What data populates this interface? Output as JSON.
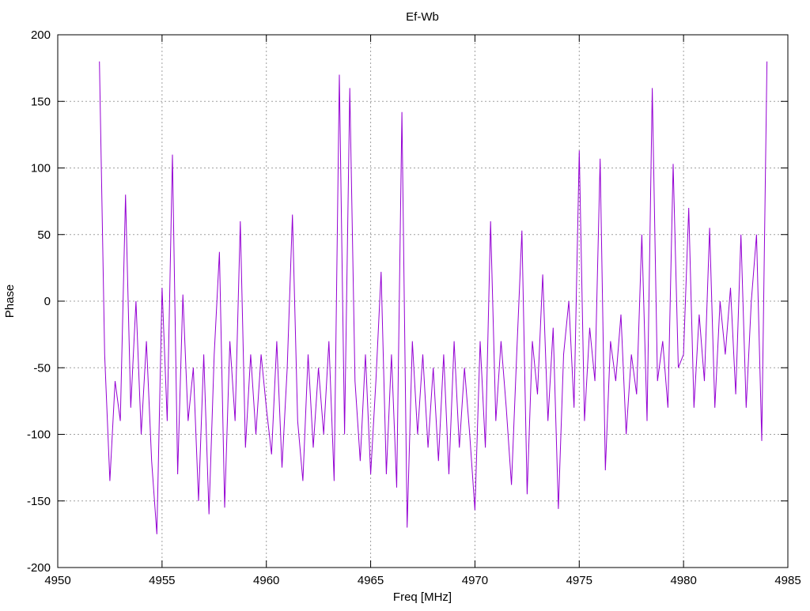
{
  "chart_data": {
    "type": "line",
    "title": "Ef-Wb",
    "xlabel": "Freq [MHz]",
    "ylabel": "Phase",
    "xlim": [
      4950,
      4985
    ],
    "ylim": [
      -200,
      200
    ],
    "xticks": [
      4950,
      4955,
      4960,
      4965,
      4970,
      4975,
      4980,
      4985
    ],
    "yticks": [
      -200,
      -150,
      -100,
      -50,
      0,
      50,
      100,
      150,
      200
    ],
    "grid": true,
    "legend": "none",
    "series": [
      {
        "name": "Ef-Wb",
        "color": "#9400d3",
        "x_start": 4952.0,
        "x_step": 0.25,
        "values": [
          180,
          -40,
          -135,
          -60,
          -90,
          80,
          -80,
          0,
          -100,
          -30,
          -120,
          -175,
          10,
          -90,
          110,
          -130,
          5,
          -90,
          -50,
          -150,
          -40,
          -160,
          -40,
          37,
          -155,
          -30,
          -90,
          60,
          -110,
          -40,
          -100,
          -40,
          -80,
          -115,
          -30,
          -125,
          -50,
          65,
          -90,
          -135,
          -40,
          -110,
          -50,
          -100,
          -30,
          -135,
          170,
          -100,
          160,
          -60,
          -120,
          -40,
          -130,
          -60,
          22,
          -130,
          -40,
          -140,
          142,
          -170,
          -30,
          -100,
          -40,
          -110,
          -50,
          -120,
          -40,
          -130,
          -30,
          -110,
          -50,
          -100,
          -157,
          -30,
          -110,
          60,
          -90,
          -30,
          -80,
          -138,
          -40,
          53,
          -145,
          -30,
          -70,
          20,
          -90,
          -20,
          -156,
          -40,
          0,
          -80,
          113,
          -90,
          -20,
          -60,
          107,
          -127,
          -30,
          -60,
          -10,
          -100,
          -40,
          -70,
          50,
          -90,
          160,
          -60,
          -30,
          -80,
          103,
          -50,
          -40,
          70,
          -80,
          -10,
          -60,
          55,
          -80,
          0,
          -40,
          10,
          -70,
          50,
          -80,
          0,
          50,
          -105,
          180
        ]
      }
    ]
  }
}
